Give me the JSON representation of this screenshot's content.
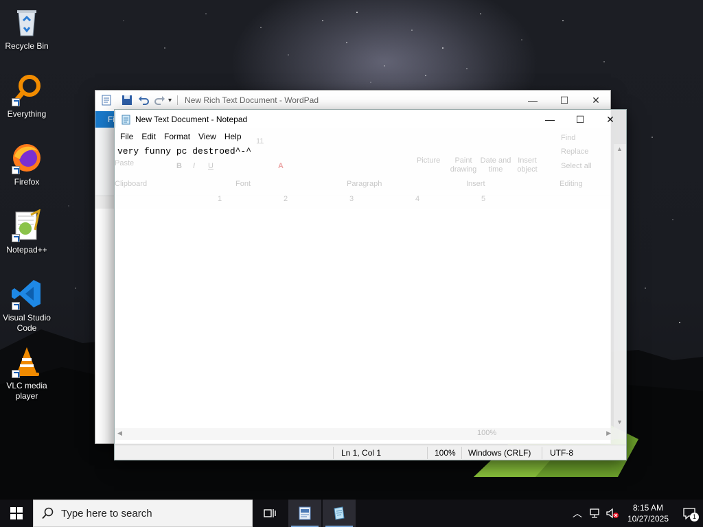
{
  "desktop_icons": [
    {
      "label": "Recycle Bin",
      "icon": "recycle-bin-icon"
    },
    {
      "label": "Everything",
      "icon": "everything-search-icon"
    },
    {
      "label": "Firefox",
      "icon": "firefox-icon"
    },
    {
      "label": "Notepad++",
      "icon": "notepad-plus-plus-icon"
    },
    {
      "label": "Visual Studio Code",
      "icon": "vscode-icon"
    },
    {
      "label": "VLC media player",
      "icon": "vlc-icon"
    }
  ],
  "wordpad": {
    "title": "New Rich Text Document - WordPad",
    "file_tab": "Fi",
    "minimize": "—",
    "maximize": "☐",
    "close": "✕"
  },
  "notepad": {
    "title": "New Text Document - Notepad",
    "menu": [
      "File",
      "Edit",
      "Format",
      "View",
      "Help"
    ],
    "content": "very funny pc destroed^-^",
    "status": {
      "position": "Ln 1, Col 1",
      "zoom": "100%",
      "line_ending": "Windows (CRLF)",
      "encoding": "UTF-8"
    },
    "minimize": "—",
    "maximize": "☐",
    "close": "✕"
  },
  "ghost_ribbon": {
    "paste": "Paste",
    "font_size": "11",
    "picture": "Picture",
    "paint_drawing": "Paint drawing",
    "date_time": "Date and time",
    "insert_object": "Insert object",
    "find": "Find",
    "replace": "Replace",
    "select_all": "Select all",
    "clipboard": "Clipboard",
    "font": "Font",
    "paragraph": "Paragraph",
    "insert": "Insert",
    "editing": "Editing",
    "ruler_marks": [
      "1",
      "2",
      "3",
      "4",
      "5"
    ],
    "zoom": "100%"
  },
  "taskbar": {
    "search_placeholder": "Type here to search",
    "time": "8:15 AM",
    "date": "10/27/2025",
    "notification_count": "1"
  },
  "colors": {
    "wordpad_blue": "#1979ca",
    "taskbar_bg": "#101014",
    "vscode_blue": "#1e88e5",
    "vlc_orange": "#f08a00"
  }
}
